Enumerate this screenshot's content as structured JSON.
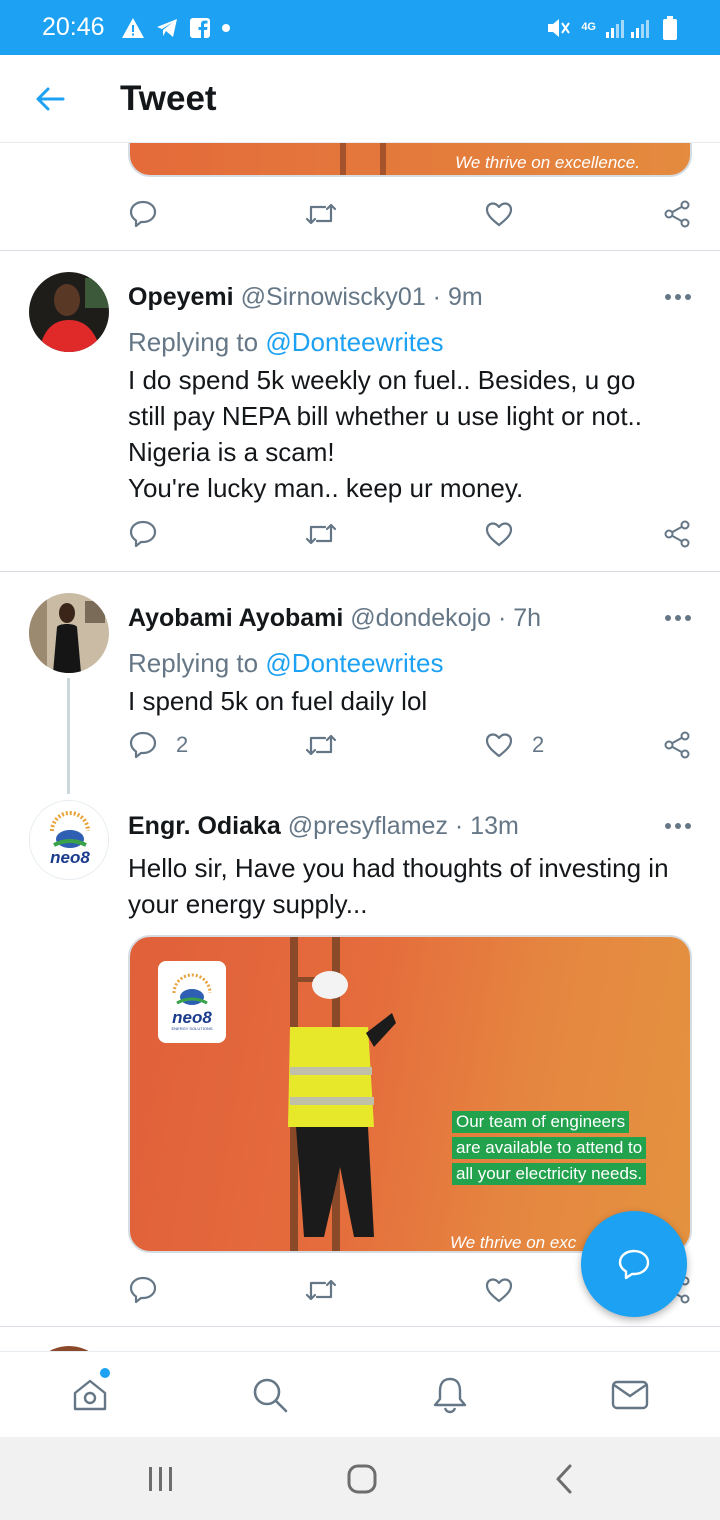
{
  "status_bar": {
    "time": "20:46",
    "network": "4G",
    "icons": [
      "alert-icon",
      "telegram-icon",
      "facebook-icon",
      "dot-icon",
      "mute-icon",
      "signal-icon",
      "battery-icon"
    ]
  },
  "header": {
    "title": "Tweet",
    "back_icon": "arrow-left-icon"
  },
  "colors": {
    "brand": "#1da1f2",
    "text": "#14171a",
    "secondary": "#657786"
  },
  "top_card": {
    "tagline": "We thrive on excellence."
  },
  "tweets": [
    {
      "name": "Opeyemi",
      "handle": "@Sirnowiscky01",
      "time": "· 9m",
      "replying_prefix": "Replying to",
      "replying_to": "@Donteewrites",
      "lines": [
        "I do spend 5k weekly on fuel.. Besides, u go",
        "still pay NEPA bill whether u use light or not..",
        "Nigeria is a scam!",
        "You're lucky man.. keep ur money."
      ],
      "reply_count": "",
      "like_count": ""
    },
    {
      "name": "Ayobami Ayobami",
      "handle": "@dondekojo",
      "time": "· 7h",
      "replying_prefix": "Replying to",
      "replying_to": "@Donteewrites",
      "lines": [
        "I spend 5k on fuel daily lol"
      ],
      "reply_count": "2",
      "like_count": "2"
    },
    {
      "name": "Engr. Odiaka",
      "handle": "@presyflamez",
      "time": "· 13m",
      "lines": [
        "Hello sir, Have you had thoughts of investing in",
        "your energy supply..."
      ],
      "media": {
        "logo_text": "neo8",
        "logo_sub": "ENERGY SOLUTIONS",
        "captions": [
          "Our team of engineers",
          "are available to attend to",
          "all your electricity needs."
        ],
        "tagline": "We thrive on exc"
      },
      "reply_count": "",
      "like_count": ""
    }
  ],
  "bottom_nav": [
    "home-icon",
    "search-icon",
    "notifications-icon",
    "messages-icon"
  ],
  "system_nav": [
    "recent-apps-icon",
    "home-button-icon",
    "back-icon"
  ]
}
